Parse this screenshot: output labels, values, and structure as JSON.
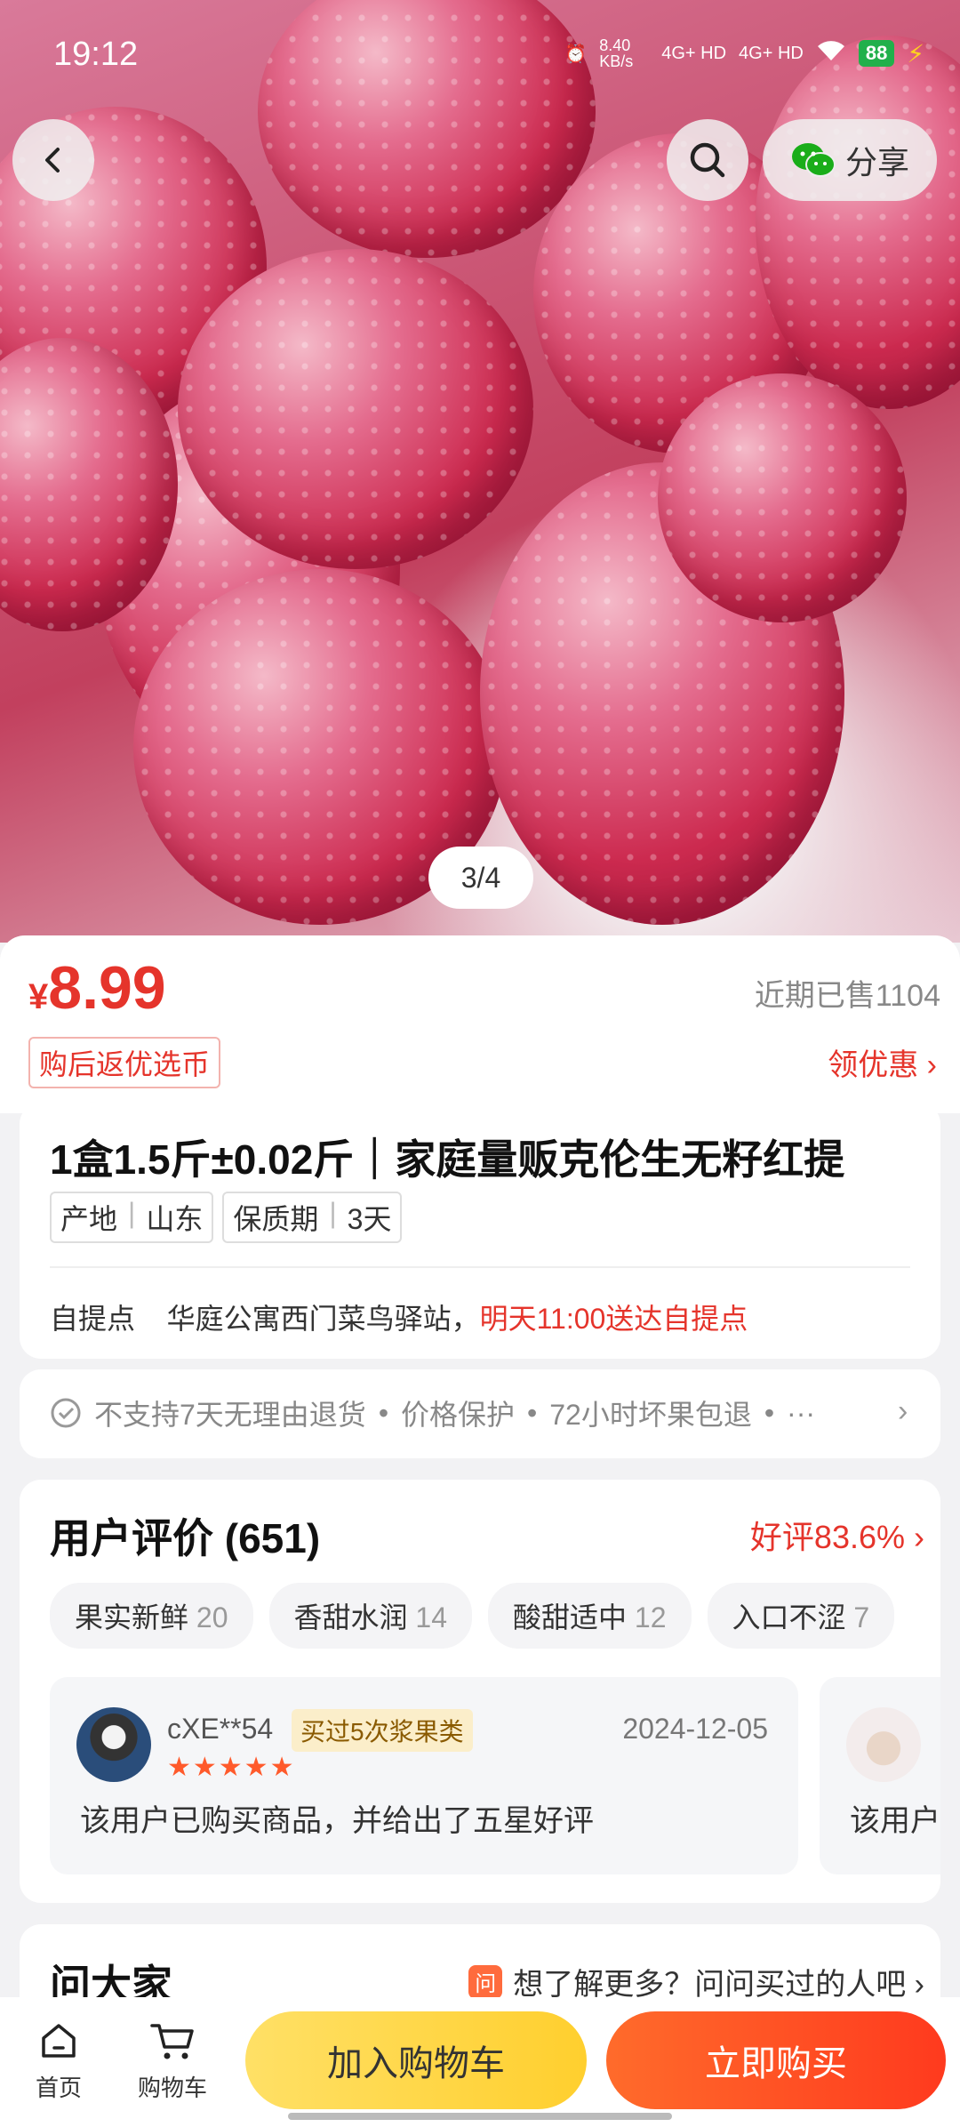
{
  "status_bar": {
    "time": "19:12",
    "net_speed": "8.40 KB/s",
    "signal1": "4G+ HD",
    "signal2": "4G+ HD",
    "battery": "88"
  },
  "header": {
    "share_label": "分享",
    "pager": "3/4"
  },
  "price": {
    "symbol": "¥",
    "value": "8.99",
    "sold": "近期已售1104",
    "coin_badge": "购后返优选币",
    "coupon": "领优惠 ›"
  },
  "product": {
    "title": "1盒1.5斤±0.02斤｜家庭量贩克伦生无籽红提",
    "tags": [
      {
        "key": "产地",
        "value": "山东"
      },
      {
        "key": "保质期",
        "value": "3天"
      }
    ],
    "pickup_label": "自提点",
    "pickup_place": "华庭公寓西门菜鸟驿站，",
    "pickup_time": "明天11:00送达自提点"
  },
  "service": {
    "items": [
      "不支持7天无理由退货",
      "价格保护",
      "72小时坏果包退",
      "···"
    ]
  },
  "reviews": {
    "title": "用户评价 (651)",
    "good_rate": "好评83.6% ›",
    "chips": [
      {
        "label": "果实新鲜",
        "count": "20"
      },
      {
        "label": "香甜水润",
        "count": "14"
      },
      {
        "label": "酸甜适中",
        "count": "12"
      },
      {
        "label": "入口不涩",
        "count": "7"
      }
    ],
    "items": [
      {
        "user": "cXE**54",
        "badge": "买过5次浆果类",
        "stars": "★★★★★",
        "date": "2024-12-05",
        "text": "该用户已购买商品，并给出了五星好评"
      },
      {
        "user": "",
        "badge": "",
        "stars": "",
        "date": "",
        "text": "该用户"
      }
    ]
  },
  "ask": {
    "title": "问大家",
    "icon_text": "问",
    "prompt": "想了解更多？问问买过的人吧 ›"
  },
  "bottom_bar": {
    "home": "首页",
    "cart": "购物车",
    "add_to_cart": "加入购物车",
    "buy_now": "立即购买"
  },
  "colors": {
    "accent_red": "#e5342b",
    "cart_yellow": "#ffcf2e",
    "buy_orange": "#ff4a24"
  }
}
